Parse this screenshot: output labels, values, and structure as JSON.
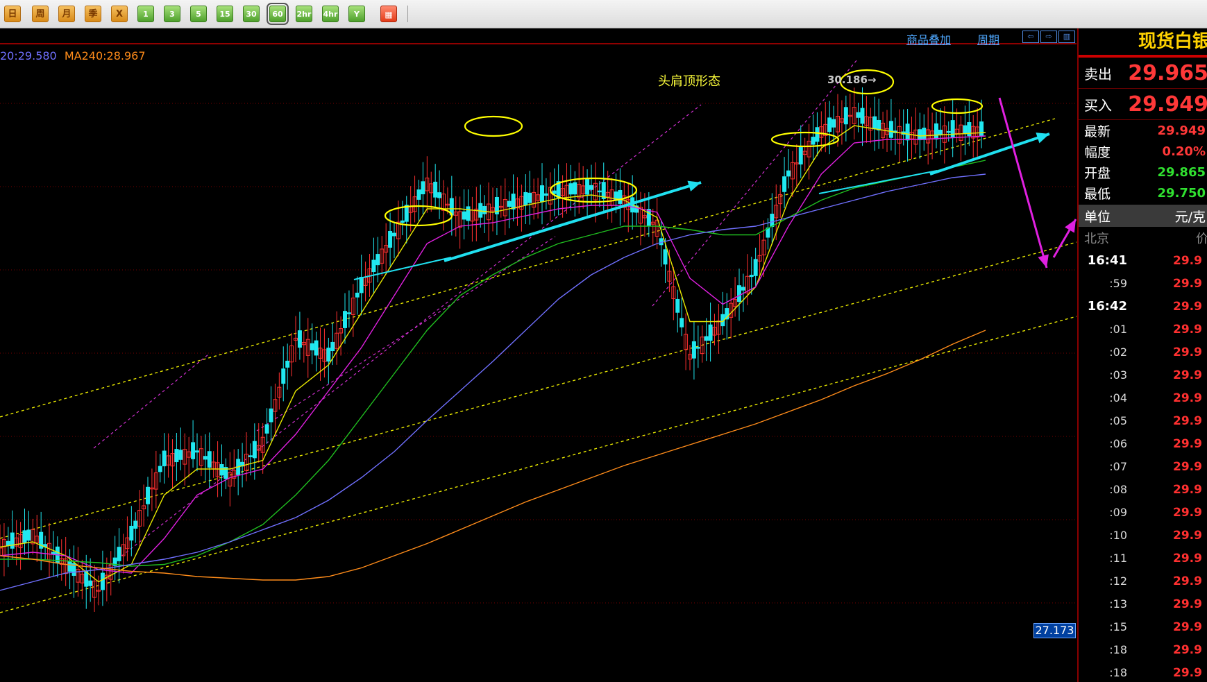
{
  "toolbar": {
    "buttons": [
      {
        "label": "日",
        "style": "y"
      },
      {
        "label": "周",
        "style": "y"
      },
      {
        "label": "月",
        "style": "y"
      },
      {
        "label": "季",
        "style": "y"
      },
      {
        "label": "X",
        "style": "y"
      },
      {
        "label": "1",
        "style": "g"
      },
      {
        "label": "3",
        "style": "g"
      },
      {
        "label": "5",
        "style": "g"
      },
      {
        "label": "15",
        "style": "g"
      },
      {
        "label": "30",
        "style": "g"
      },
      {
        "label": "60",
        "style": "g",
        "selected": true
      },
      {
        "label": "2hr",
        "style": "g"
      },
      {
        "label": "4hr",
        "style": "g"
      },
      {
        "label": "Y",
        "style": "g"
      },
      {
        "label": "▦",
        "style": "r"
      }
    ]
  },
  "header": {
    "overlay_link": "商品叠加",
    "period_link": "周期"
  },
  "ma_legend": [
    {
      "text": "20:29.580",
      "color": "#7070ff"
    },
    {
      "text": "MA240:28.967",
      "color": "#ff8c1a"
    }
  ],
  "annotations": {
    "pattern_title": "头肩顶形态",
    "peak_label": "30.186→",
    "price_tag": "27.173"
  },
  "quote": {
    "title": "现货白银",
    "sell": {
      "label": "卖出",
      "value": "29.965"
    },
    "buy": {
      "label": "买入",
      "value": "29.949"
    },
    "rows": [
      {
        "label": "最新",
        "value": "29.949",
        "color": "#ff3838"
      },
      {
        "label": "幅度",
        "value": "0.20%",
        "color": "#ff3838"
      },
      {
        "label": "开盘",
        "value": "29.865",
        "color": "#30e030"
      },
      {
        "label": "最低",
        "value": "29.750",
        "color": "#30e030"
      }
    ],
    "unit": {
      "label": "单位",
      "value": "元/克"
    },
    "city": {
      "label": "北京",
      "value": "价"
    },
    "ticks": [
      {
        "time": "16:41",
        "bold": true,
        "price": "29.9"
      },
      {
        "time": ":59",
        "price": "29.9"
      },
      {
        "time": "16:42",
        "bold": true,
        "price": "29.9"
      },
      {
        "time": ":01",
        "price": "29.9"
      },
      {
        "time": ":02",
        "price": "29.9"
      },
      {
        "time": ":03",
        "price": "29.9"
      },
      {
        "time": ":04",
        "price": "29.9"
      },
      {
        "time": ":05",
        "price": "29.9"
      },
      {
        "time": ":06",
        "price": "29.9"
      },
      {
        "time": ":07",
        "price": "29.9"
      },
      {
        "time": ":08",
        "price": "29.9"
      },
      {
        "time": ":09",
        "price": "29.9"
      },
      {
        "time": ":10",
        "price": "29.9"
      },
      {
        "time": ":11",
        "price": "29.9"
      },
      {
        "time": ":12",
        "price": "29.9"
      },
      {
        "time": ":13",
        "price": "29.9"
      },
      {
        "time": ":15",
        "price": "29.9"
      },
      {
        "time": ":18",
        "price": "29.9"
      },
      {
        "time": ":18",
        "price": "29.9"
      }
    ]
  },
  "chart_data": {
    "type": "line",
    "title": "头肩顶形态",
    "note_peak": "30.186",
    "ylim": [
      26.8,
      30.4
    ],
    "x": [
      0,
      10,
      20,
      30,
      40,
      50,
      60,
      70,
      80,
      90,
      100,
      110,
      120,
      130,
      140,
      150,
      160,
      170,
      180,
      190,
      200,
      210,
      220,
      230,
      240,
      250,
      260,
      270,
      280,
      290,
      300
    ],
    "series": [
      {
        "name": "close",
        "color": "#ffffff",
        "values": [
          27.55,
          27.62,
          27.45,
          27.3,
          27.62,
          28.05,
          28.1,
          27.95,
          28.15,
          28.75,
          28.65,
          29.05,
          29.35,
          29.65,
          29.45,
          29.5,
          29.55,
          29.6,
          29.62,
          29.55,
          29.4,
          28.65,
          28.85,
          29.15,
          29.7,
          29.95,
          30.05,
          29.95,
          29.92,
          29.95,
          29.95
        ]
      },
      {
        "name": "ma-yellow",
        "color": "#e8e800",
        "values": [
          27.55,
          27.58,
          27.5,
          27.35,
          27.45,
          27.85,
          28.0,
          28.0,
          28.05,
          28.45,
          28.6,
          28.9,
          29.2,
          29.5,
          29.5,
          29.48,
          29.52,
          29.56,
          29.58,
          29.55,
          29.45,
          28.85,
          28.85,
          29.05,
          29.55,
          29.85,
          29.98,
          29.95,
          29.92,
          29.93,
          29.94
        ]
      },
      {
        "name": "ma-magenta",
        "color": "#e020e0",
        "values": [
          27.5,
          27.52,
          27.5,
          27.42,
          27.4,
          27.6,
          27.85,
          27.95,
          28.0,
          28.2,
          28.45,
          28.7,
          29.0,
          29.3,
          29.4,
          29.42,
          29.46,
          29.5,
          29.52,
          29.52,
          29.48,
          29.1,
          28.95,
          29.05,
          29.4,
          29.7,
          29.88,
          29.9,
          29.9,
          29.91,
          29.92
        ]
      },
      {
        "name": "ma-green",
        "color": "#20c020",
        "values": [
          27.48,
          27.48,
          27.47,
          27.46,
          27.44,
          27.45,
          27.5,
          27.58,
          27.68,
          27.85,
          28.05,
          28.3,
          28.55,
          28.8,
          29.0,
          29.12,
          29.22,
          29.3,
          29.35,
          29.4,
          29.4,
          29.38,
          29.35,
          29.35,
          29.45,
          29.55,
          29.62,
          29.66,
          29.7,
          29.74,
          29.78
        ]
      },
      {
        "name": "MA20",
        "color": "#7070ff",
        "values": [
          27.3,
          27.35,
          27.4,
          27.42,
          27.45,
          27.48,
          27.52,
          27.58,
          27.65,
          27.72,
          27.82,
          27.95,
          28.1,
          28.28,
          28.45,
          28.62,
          28.8,
          28.98,
          29.12,
          29.22,
          29.3,
          29.35,
          29.38,
          29.4,
          29.45,
          29.5,
          29.55,
          29.6,
          29.64,
          29.68,
          29.7
        ]
      },
      {
        "name": "MA240",
        "color": "#ff8c1a",
        "values": [
          27.5,
          27.48,
          27.45,
          27.43,
          27.41,
          27.4,
          27.38,
          27.37,
          27.36,
          27.36,
          27.38,
          27.43,
          27.5,
          27.57,
          27.65,
          27.73,
          27.81,
          27.88,
          27.95,
          28.02,
          28.08,
          28.14,
          28.2,
          28.26,
          28.33,
          28.4,
          28.48,
          28.55,
          28.63,
          28.72,
          28.8
        ]
      }
    ]
  }
}
